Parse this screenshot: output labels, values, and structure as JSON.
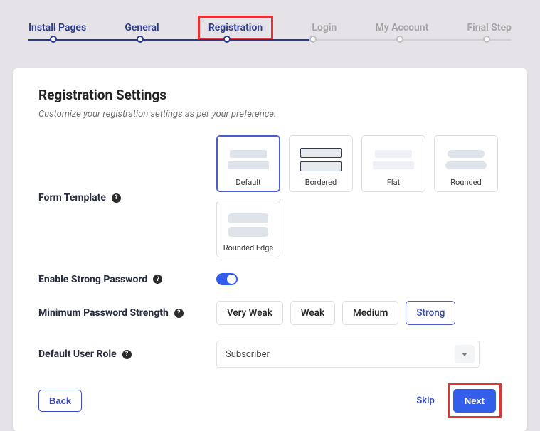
{
  "steps": {
    "install_pages": "Install Pages",
    "general": "General",
    "registration": "Registration",
    "login": "Login",
    "my_account": "My Account",
    "final_step": "Final Step"
  },
  "header": {
    "title": "Registration Settings",
    "subtitle": "Customize your registration settings as per your preference."
  },
  "labels": {
    "form_template": "Form Template",
    "enable_strong_password": "Enable Strong Password",
    "min_password_strength": "Minimum Password Strength",
    "default_user_role": "Default User Role"
  },
  "templates": {
    "default": "Default",
    "bordered": "Bordered",
    "flat": "Flat",
    "rounded": "Rounded",
    "rounded_edge": "Rounded Edge"
  },
  "strength": {
    "very_weak": "Very Weak",
    "weak": "Weak",
    "medium": "Medium",
    "strong": "Strong"
  },
  "select": {
    "user_role_value": "Subscriber"
  },
  "footer": {
    "back": "Back",
    "skip": "Skip",
    "next": "Next"
  },
  "help_glyph": "?",
  "colors": {
    "primary": "#335eea",
    "highlight_frame": "#e23434"
  }
}
